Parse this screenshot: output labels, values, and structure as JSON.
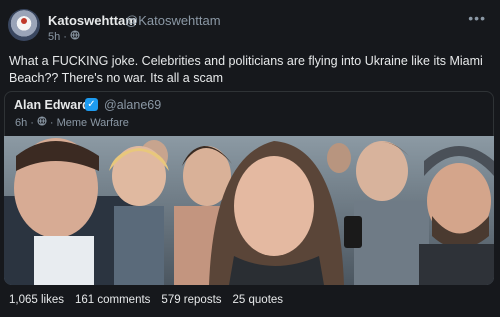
{
  "post": {
    "display_name": "Katoswehttam",
    "handle": "@Katoswehttam",
    "time": "5h",
    "separator": "·",
    "text": "What a FUCKING joke. Celebrities and politicians are flying into Ukraine like its Miami Beach?? There's no war. Its all a scam"
  },
  "quote": {
    "display_name": "Alan Edward",
    "handle": "@alane69",
    "time": "6h",
    "separator": "·",
    "community": "Meme Warfare"
  },
  "stats": {
    "likes": "1,065 likes",
    "comments": "161 comments",
    "reposts": "579 reposts",
    "quotes": "25 quotes"
  },
  "icons": {
    "more": "more-icon",
    "audience": "globe-icon",
    "verified": "verified-badge-icon"
  },
  "colors": {
    "background": "#16181c",
    "text": "#e7e9ea",
    "muted": "#8b98a5",
    "accent": "#1d9bf0",
    "border": "#2f3336"
  }
}
